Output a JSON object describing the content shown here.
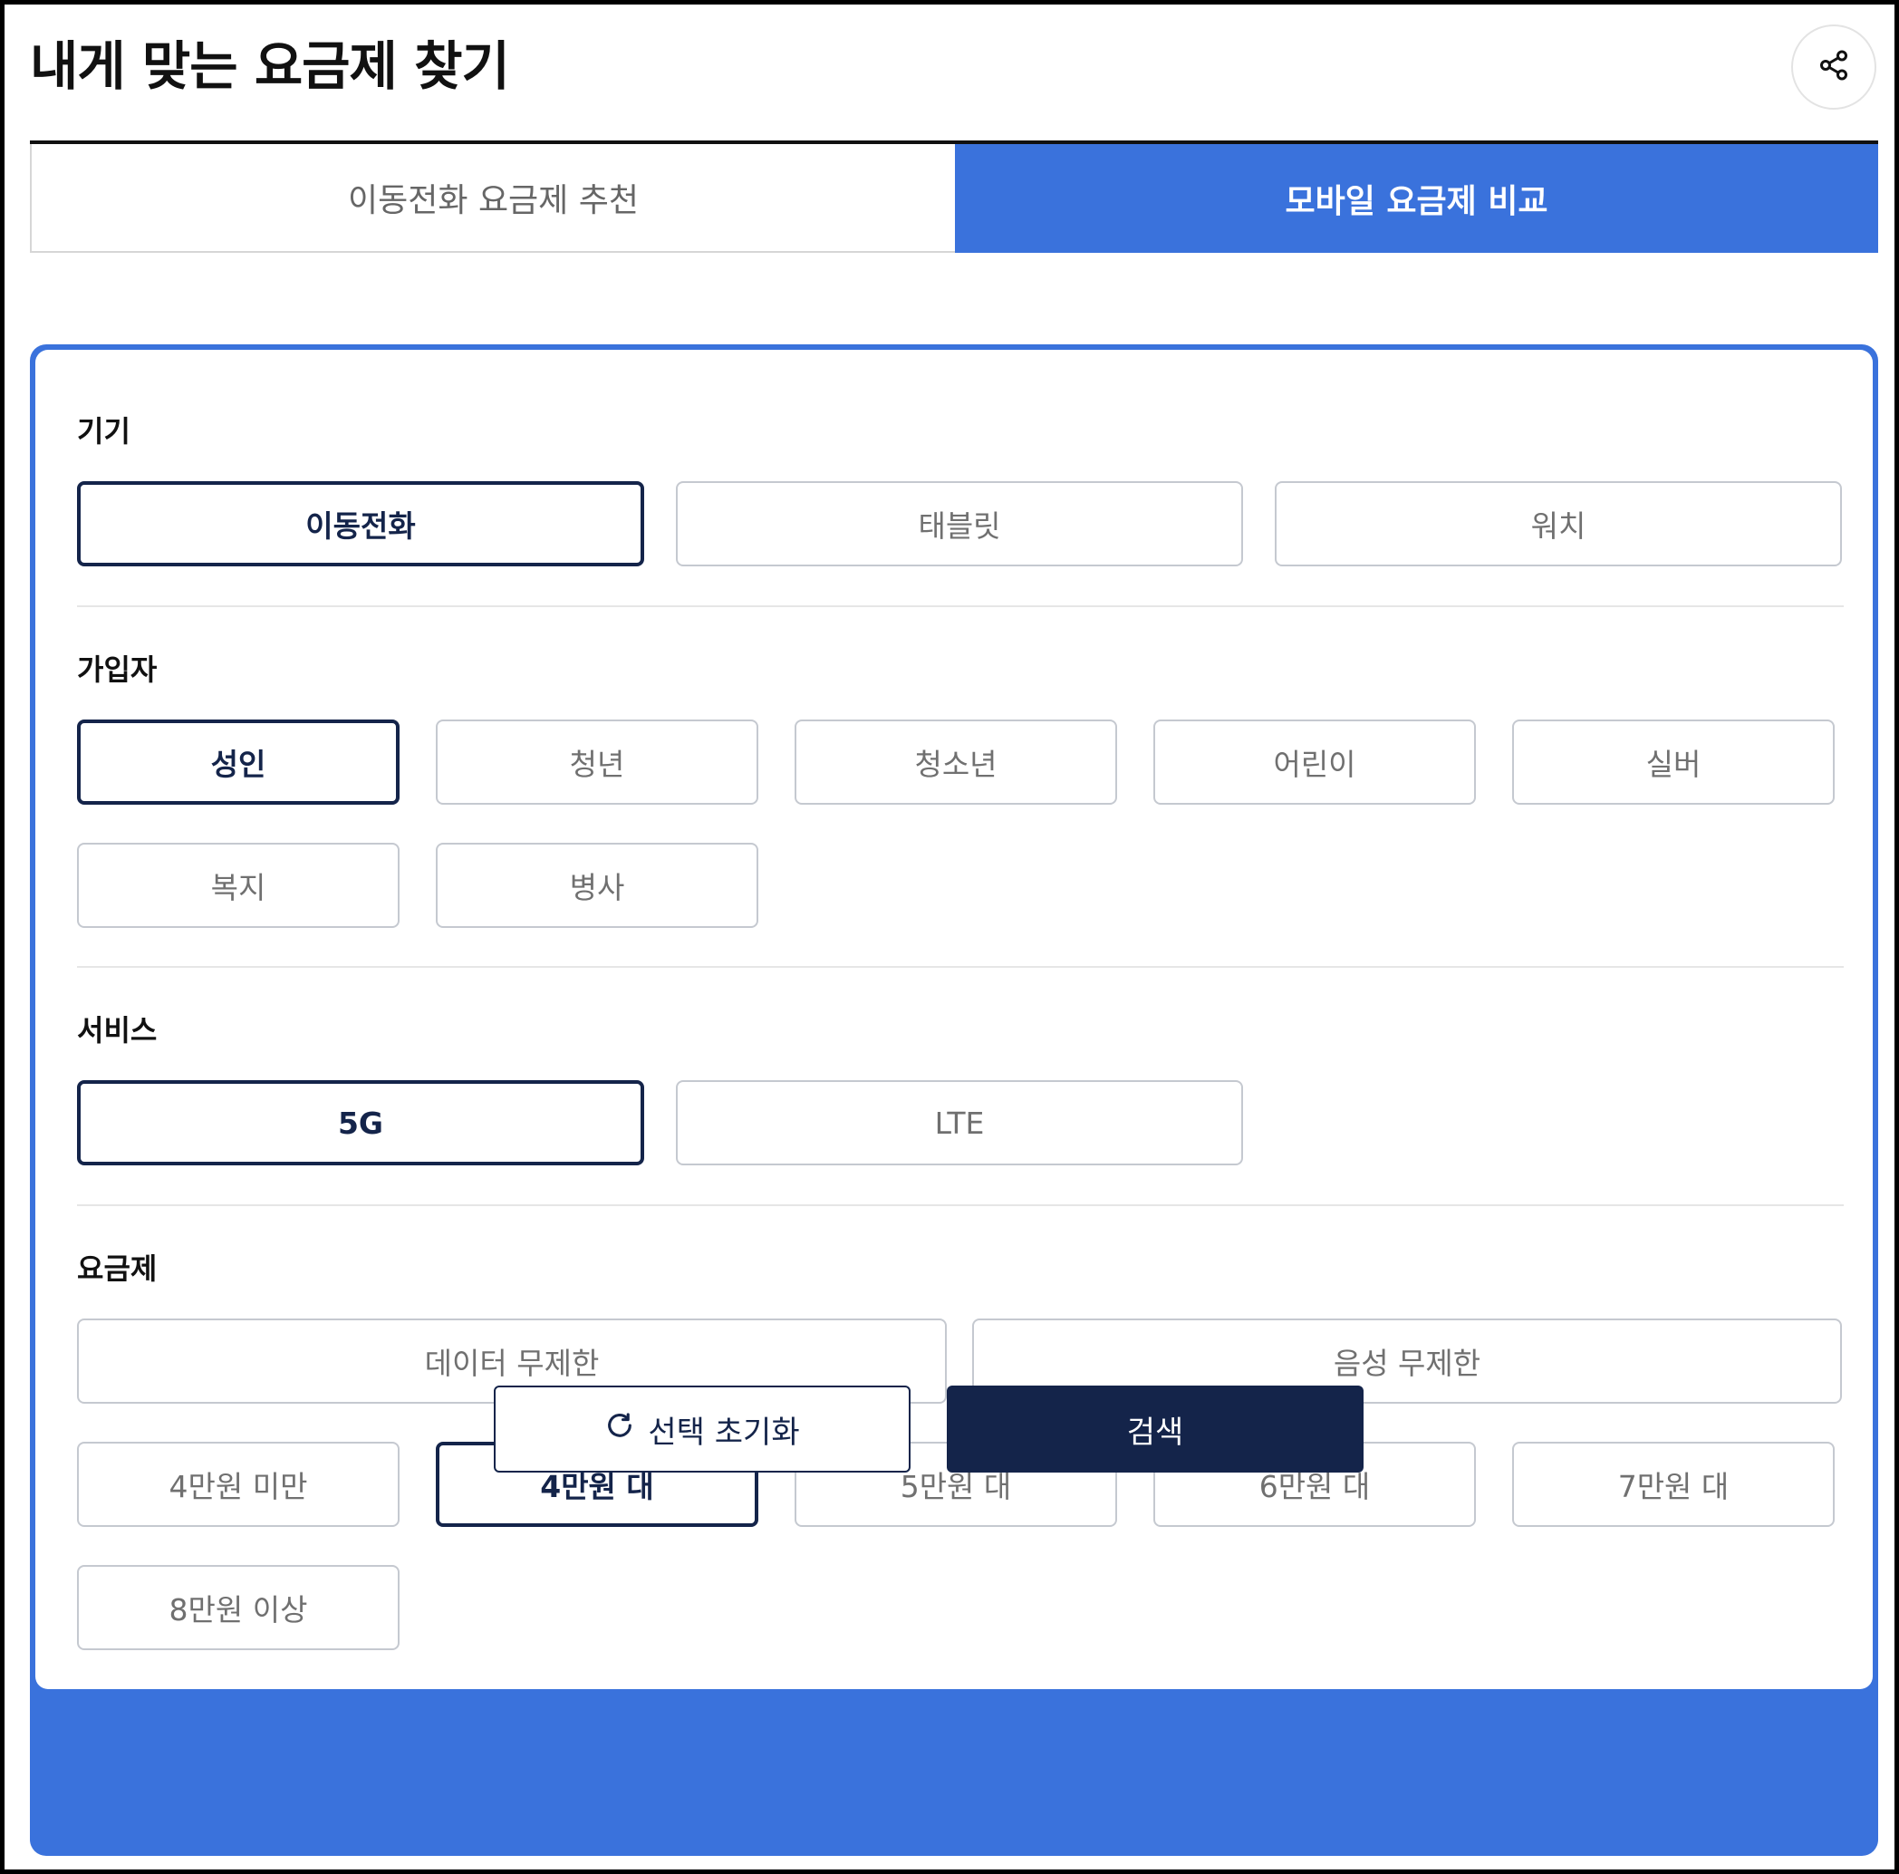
{
  "header": {
    "title": "내게 맞는 요금제 찾기",
    "share_icon": "share-icon"
  },
  "tabs": [
    {
      "label": "이동전화 요금제 추천",
      "active": false
    },
    {
      "label": "모바일 요금제 비교",
      "active": true
    }
  ],
  "sections": {
    "device": {
      "label": "기기",
      "options": [
        {
          "label": "이동전화",
          "selected": true
        },
        {
          "label": "태블릿",
          "selected": false
        },
        {
          "label": "워치",
          "selected": false
        }
      ]
    },
    "subscriber": {
      "label": "가입자",
      "options": [
        {
          "label": "성인",
          "selected": true
        },
        {
          "label": "청년",
          "selected": false
        },
        {
          "label": "청소년",
          "selected": false
        },
        {
          "label": "어린이",
          "selected": false
        },
        {
          "label": "실버",
          "selected": false
        },
        {
          "label": "복지",
          "selected": false
        },
        {
          "label": "병사",
          "selected": false
        }
      ]
    },
    "service": {
      "label": "서비스",
      "options": [
        {
          "label": "5G",
          "selected": true
        },
        {
          "label": "LTE",
          "selected": false
        }
      ]
    },
    "plan": {
      "label": "요금제",
      "unlimited": [
        {
          "label": "데이터 무제한",
          "selected": false
        },
        {
          "label": "음성 무제한",
          "selected": false
        }
      ],
      "price_ranges": [
        {
          "label": "4만원 미만",
          "selected": false
        },
        {
          "label": "4만원 대",
          "selected": true
        },
        {
          "label": "5만원 대",
          "selected": false
        },
        {
          "label": "6만원 대",
          "selected": false
        },
        {
          "label": "7만원 대",
          "selected": false
        },
        {
          "label": "8만원 이상",
          "selected": false
        }
      ]
    }
  },
  "actions": {
    "reset_label": "선택 초기화",
    "reset_icon": "refresh-icon",
    "search_label": "검색"
  },
  "colors": {
    "accent_blue": "#3a72dc",
    "navy": "#14244a",
    "option_border": "#c5c9d0",
    "option_text": "#707070"
  }
}
